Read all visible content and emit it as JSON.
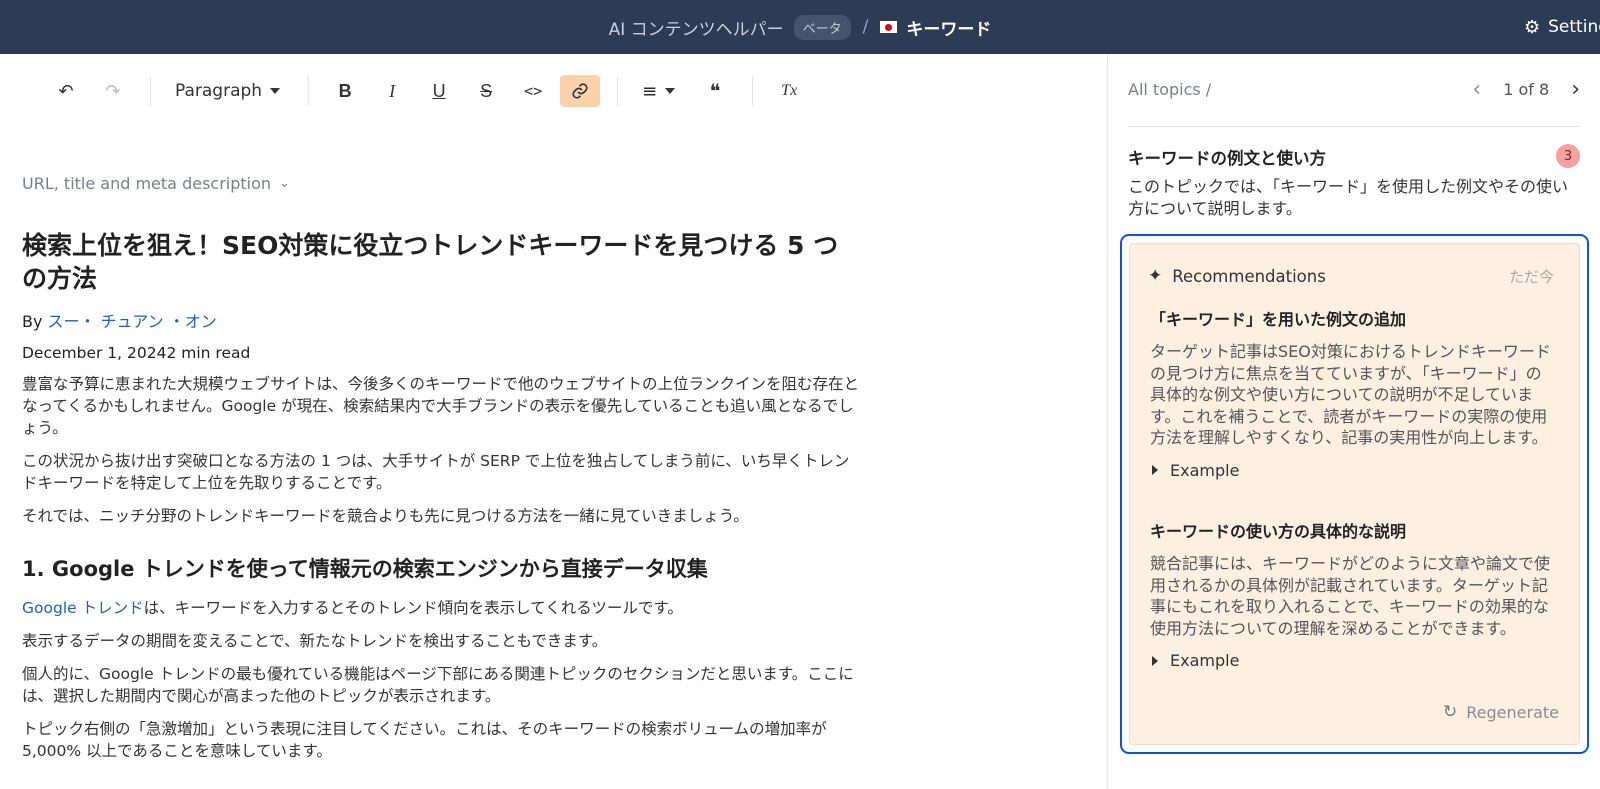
{
  "topbar": {
    "app_title": "AI コンテンツヘルパー",
    "beta": "ベータ",
    "separator": "/",
    "keyword": "キーワード",
    "settings": "Settings",
    "flag_colors": {
      "field": "#ffffff",
      "disc": "#d0021b"
    }
  },
  "toolbar": {
    "undo_icon": "↶",
    "redo_icon": "↷",
    "paragraph": "Paragraph",
    "bold": "B",
    "italic": "I",
    "underline": "U",
    "strike": "S",
    "code": "<>",
    "link_icon": "🔗",
    "align_icon": "≡",
    "quote_icon": "❝",
    "clear_format": "Tx"
  },
  "meta_toggle": "URL, title and meta description",
  "article": {
    "title": "検索上位を狙え！SEO対策に役立つトレンドキーワードを見つける 5 つの方法",
    "by": "By ",
    "author": "スー・ チュアン ・オン",
    "date": "December 1, 20242 min read",
    "p1": "豊富な予算に恵まれた大規模ウェブサイトは、今後多くのキーワードで他のウェブサイトの上位ランクインを阻む存在となってくるかもしれません。Google が現在、検索結果内で大手ブランドの表示を優先していることも追い風となるでしょう。",
    "p2": "この状況から抜け出す突破口となる方法の 1 つは、大手サイトが SERP で上位を独占してしまう前に、いち早くトレンドキーワードを特定して上位を先取りすることです。",
    "p3": "それでは、ニッチ分野のトレンドキーワードを競合よりも先に見つける方法を一緒に見ていきましょう。",
    "h2": "1. Google トレンドを使って情報元の検索エンジンから直接データ収集",
    "p4_link": "Google トレンド",
    "p4_rest": "は、キーワードを入力するとそのトレンド傾向を表示してくれるツールです。",
    "p5": "表示するデータの期間を変えることで、新たなトレンドを検出することもできます。",
    "p6": "個人的に、Google トレンドの最も優れている機能はページ下部にある関連トピックのセクションだと思います。ここには、選択した期間内で関心が高まった他のトピックが表示されます。",
    "p7": "トピック右側の「急激増加」という表現に注目してください。これは、そのキーワードの検索ボリュームの増加率が 5,000% 以上であることを意味しています。"
  },
  "panel": {
    "breadcrumb": "All topics /",
    "prev_icon": "‹",
    "next_icon": "›",
    "page": "1 of 8",
    "topic_title": "キーワードの例文と使い方",
    "topic_count": "3",
    "topic_desc": "このトピックでは、「キーワード」を使用した例文やその使い方について説明します。",
    "recommendations": {
      "title": "Recommendations",
      "time": "ただ今",
      "items": [
        {
          "heading": "「キーワード」を用いた例文の追加",
          "body": "ターゲット記事はSEO対策におけるトレンドキーワードの見つけ方に焦点を当てていますが、「キーワード」の具体的な例文や使い方についての説明が不足しています。これを補うことで、読者がキーワードの実際の使用方法を理解しやすくなり、記事の実用性が向上します。",
          "example": "Example"
        },
        {
          "heading": "キーワードの使い方の具体的な説明",
          "body": "競合記事には、キーワードがどのように文章や論文で使用されるかの具体例が記載されています。ターゲット記事にもこれを取り入れることで、キーワードの効果的な使用方法についての理解を深めることができます。",
          "example": "Example"
        }
      ],
      "regenerate": "Regenerate"
    }
  }
}
